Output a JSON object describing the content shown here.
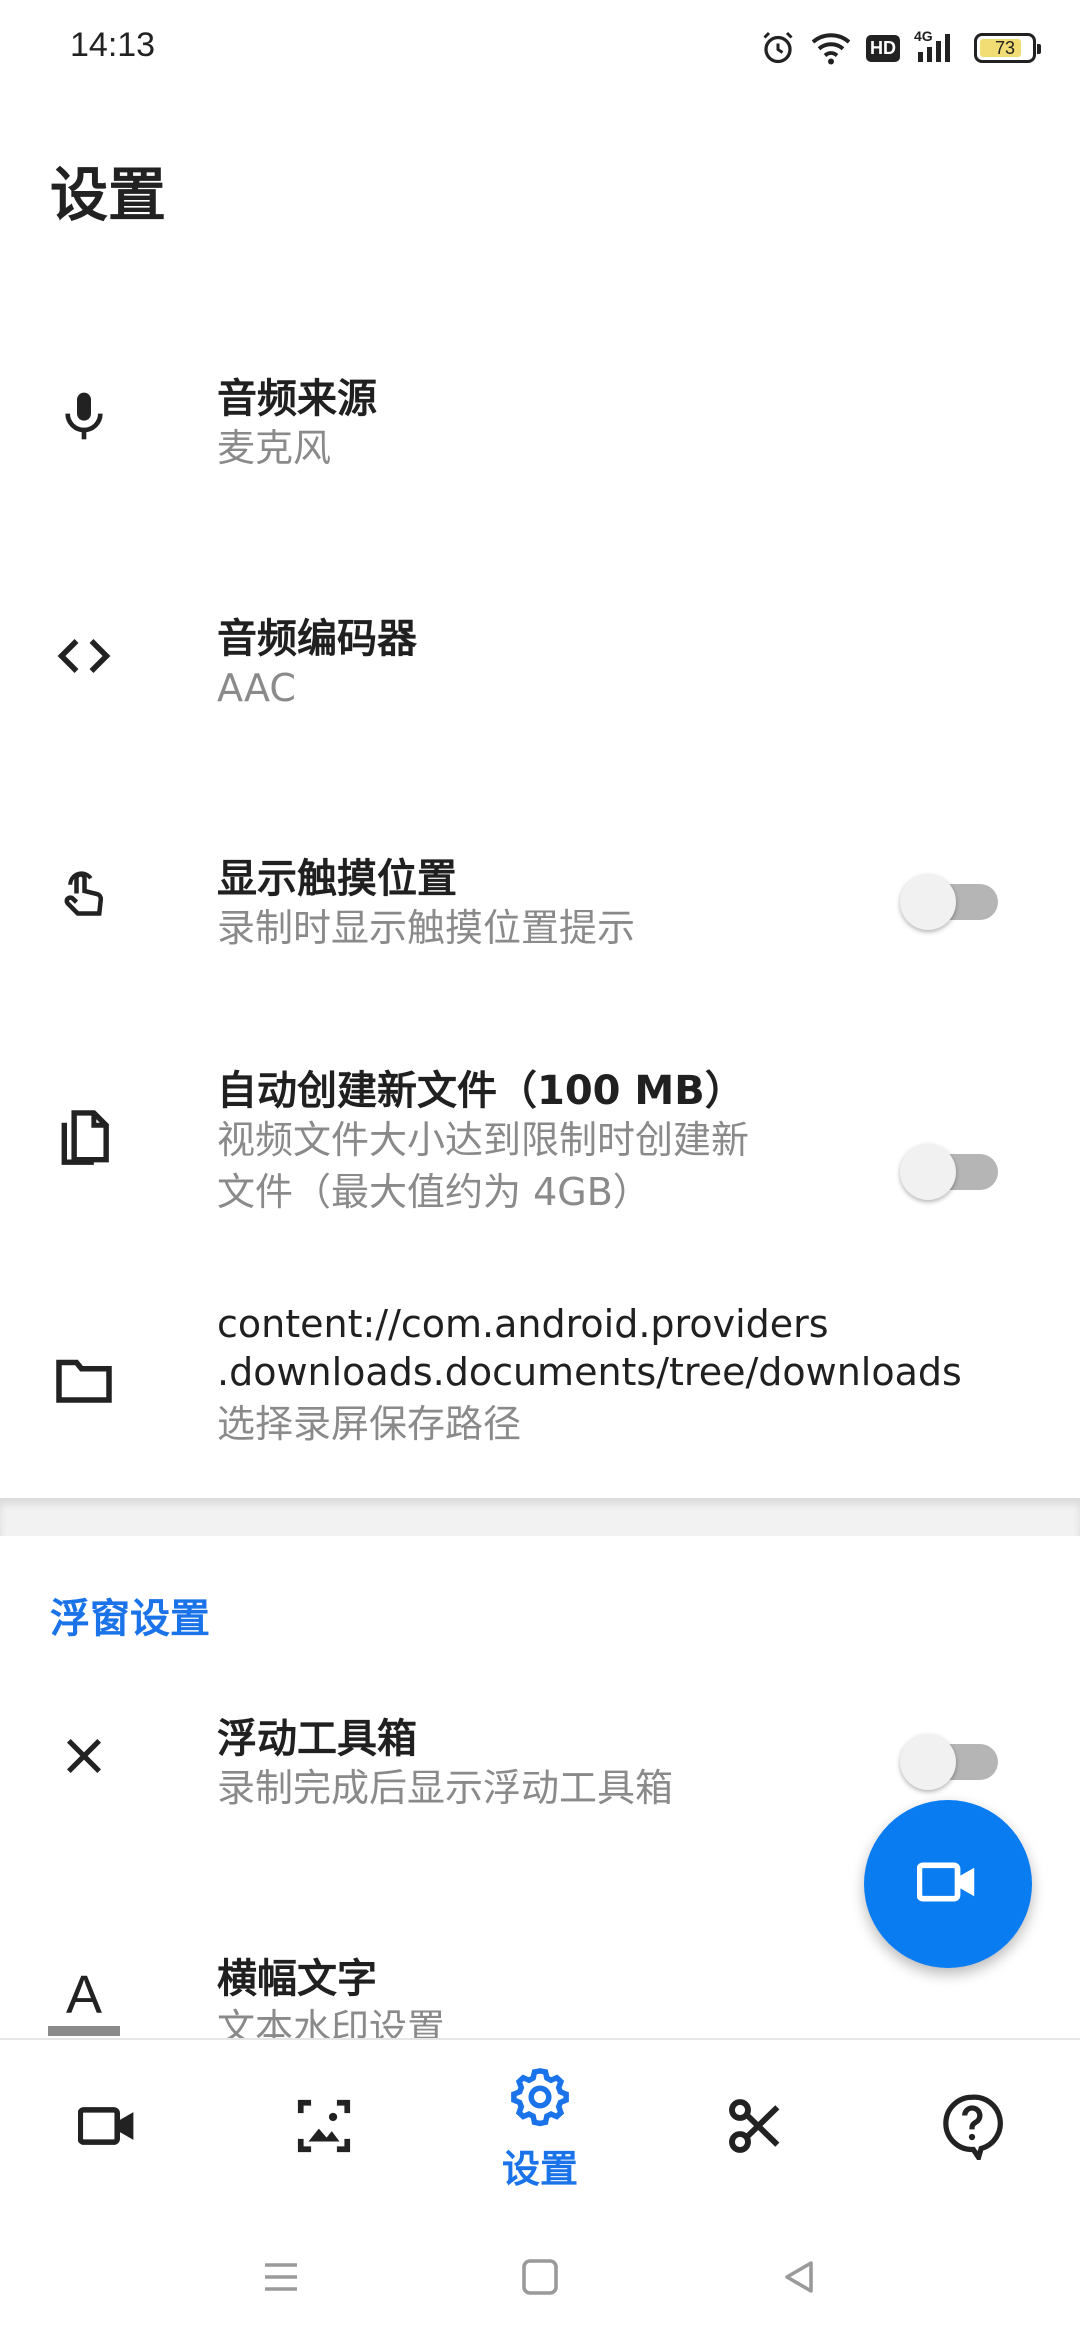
{
  "status_bar": {
    "time": "14:13",
    "battery": "73",
    "network_label": "4G",
    "hd_label": "HD"
  },
  "page": {
    "title": "设置"
  },
  "settings": [
    {
      "title": "音频来源",
      "subtitle": "麦克风",
      "icon": "mic-icon"
    },
    {
      "title": "音频编码器",
      "subtitle": "AAC",
      "icon": "code-brackets-icon"
    },
    {
      "title": "显示触摸位置",
      "subtitle": "录制时显示触摸位置提示",
      "icon": "touch-hand-icon",
      "toggle": false
    },
    {
      "title": "自动创建新文件（100 MB）",
      "subtitle_line1": "视频文件大小达到限制时创建新",
      "subtitle_line2": "文件（最大值约为 4GB）",
      "icon": "copy-file-icon",
      "toggle": false
    },
    {
      "title_line1": "content://com.android.providers",
      "title_line2": ".downloads.documents/tree/downloads",
      "subtitle": "选择录屏保存路径",
      "icon": "folder-icon"
    }
  ],
  "float_section": {
    "header": "浮窗设置",
    "items": [
      {
        "title": "浮动工具箱",
        "subtitle": "录制完成后显示浮动工具箱",
        "icon": "close-x-icon",
        "toggle": false
      },
      {
        "title": "横幅文字",
        "subtitle": "文本水印设置",
        "icon": "text-format-icon",
        "icon_letter": "A"
      }
    ]
  },
  "fab": {
    "icon": "video-camera-icon"
  },
  "bottom_nav": {
    "items": [
      {
        "icon": "video-camera-icon"
      },
      {
        "icon": "image-frame-icon"
      },
      {
        "icon": "settings-gear-icon",
        "label": "设置",
        "active": true
      },
      {
        "icon": "scissors-icon"
      },
      {
        "icon": "help-bubble-icon"
      }
    ]
  },
  "colors": {
    "accent": "#1a73e8",
    "fab": "#0a7cf2",
    "subtitle": "#8a8a8a",
    "battery_fill": "#f2dc74"
  }
}
